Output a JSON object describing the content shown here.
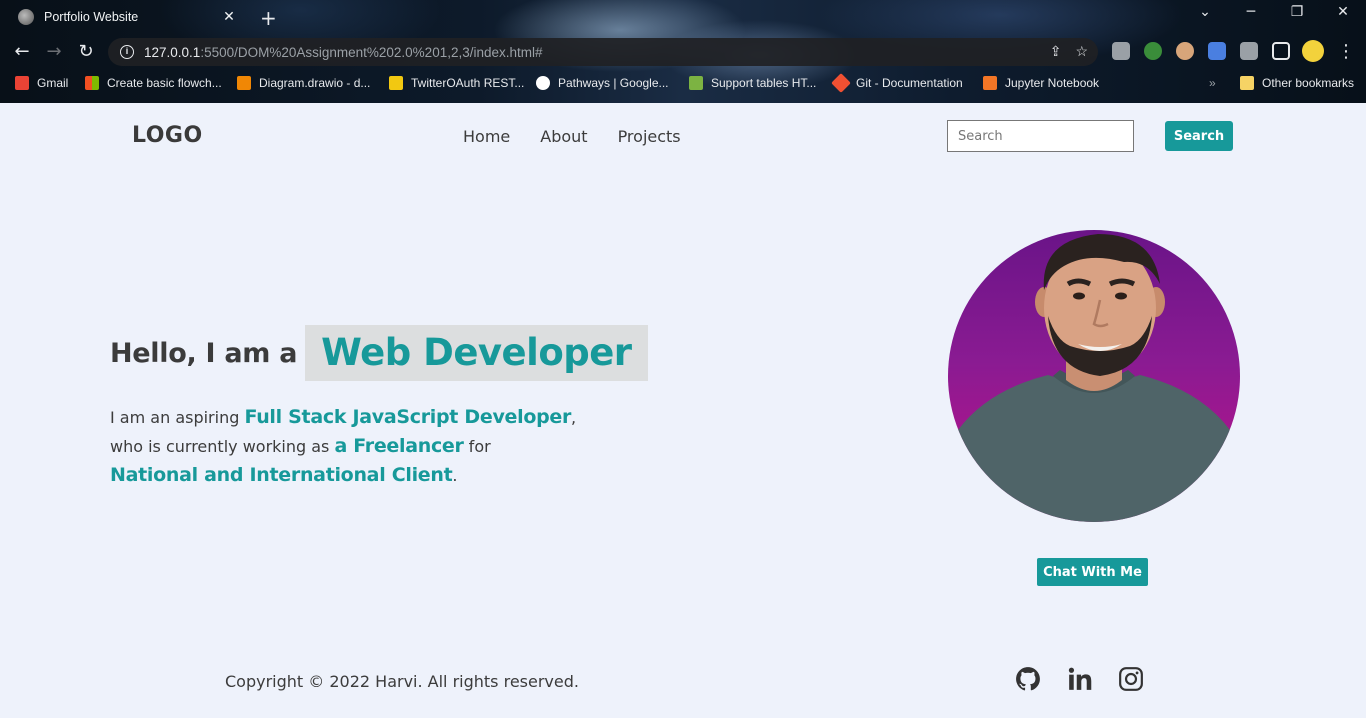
{
  "browser": {
    "tab_title": "Portfolio Website",
    "url_host": "127.0.0.1",
    "url_rest": ":5500/DOM%20Assignment%202.0%201,2,3/index.html#",
    "bookmarks": [
      {
        "label": "Gmail",
        "color": "#ea4335"
      },
      {
        "label": "Create basic flowch...",
        "color": "#f25022"
      },
      {
        "label": "Diagram.drawio - d...",
        "color": "#f08705"
      },
      {
        "label": "TwitterOAuth REST...",
        "color": "#f2c811"
      },
      {
        "label": "Pathways  |  Google...",
        "color": "#4285f4"
      },
      {
        "label": "Support tables HT...",
        "color": "#7cb342"
      },
      {
        "label": "Git - Documentation",
        "color": "#f05032"
      },
      {
        "label": "Jupyter Notebook",
        "color": "#f37626"
      }
    ],
    "other_bookmarks": "Other bookmarks"
  },
  "header": {
    "logo": "LOGO",
    "nav": [
      "Home",
      "About",
      "Projects"
    ],
    "search_placeholder": "Search",
    "search_button": "Search"
  },
  "hero": {
    "greeting": "Hello, I am a",
    "role": "Web Developer",
    "bio_1": "I am an aspiring ",
    "bio_hl_1": "Full Stack JavaScript Developer",
    "bio_2": ",",
    "bio_3": "who is currently working as ",
    "bio_hl_2": "a Freelancer",
    "bio_4": " for",
    "bio_hl_3": "National and International Client",
    "bio_5": ".",
    "chat_button": "Chat With Me"
  },
  "footer": {
    "copyright": "Copyright © 2022 Harvi. All rights reserved.",
    "social_icons": [
      "github-icon",
      "linkedin-icon",
      "instagram-icon"
    ]
  },
  "colors": {
    "accent": "#17999a",
    "page_bg": "#eef2fb",
    "role_bg": "#dcdedf"
  }
}
